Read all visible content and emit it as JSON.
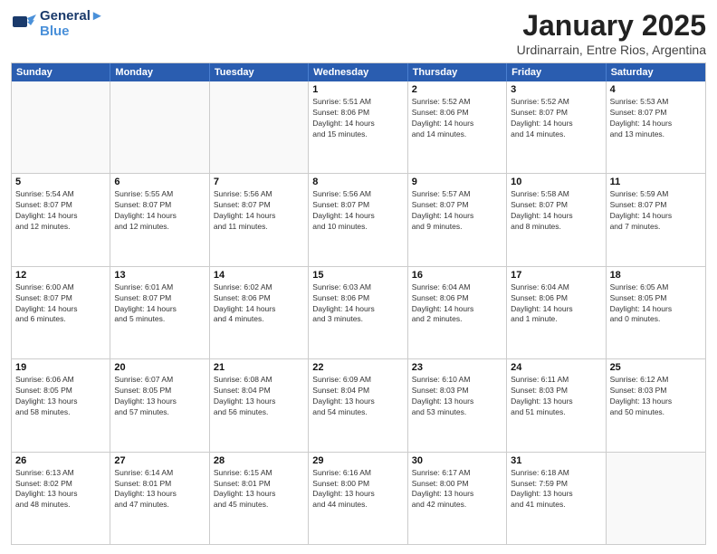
{
  "header": {
    "logo_line1": "General",
    "logo_line2": "Blue",
    "month": "January 2025",
    "location": "Urdinarrain, Entre Rios, Argentina"
  },
  "weekdays": [
    "Sunday",
    "Monday",
    "Tuesday",
    "Wednesday",
    "Thursday",
    "Friday",
    "Saturday"
  ],
  "rows": [
    [
      {
        "day": "",
        "text": ""
      },
      {
        "day": "",
        "text": ""
      },
      {
        "day": "",
        "text": ""
      },
      {
        "day": "1",
        "text": "Sunrise: 5:51 AM\nSunset: 8:06 PM\nDaylight: 14 hours\nand 15 minutes."
      },
      {
        "day": "2",
        "text": "Sunrise: 5:52 AM\nSunset: 8:06 PM\nDaylight: 14 hours\nand 14 minutes."
      },
      {
        "day": "3",
        "text": "Sunrise: 5:52 AM\nSunset: 8:07 PM\nDaylight: 14 hours\nand 14 minutes."
      },
      {
        "day": "4",
        "text": "Sunrise: 5:53 AM\nSunset: 8:07 PM\nDaylight: 14 hours\nand 13 minutes."
      }
    ],
    [
      {
        "day": "5",
        "text": "Sunrise: 5:54 AM\nSunset: 8:07 PM\nDaylight: 14 hours\nand 12 minutes."
      },
      {
        "day": "6",
        "text": "Sunrise: 5:55 AM\nSunset: 8:07 PM\nDaylight: 14 hours\nand 12 minutes."
      },
      {
        "day": "7",
        "text": "Sunrise: 5:56 AM\nSunset: 8:07 PM\nDaylight: 14 hours\nand 11 minutes."
      },
      {
        "day": "8",
        "text": "Sunrise: 5:56 AM\nSunset: 8:07 PM\nDaylight: 14 hours\nand 10 minutes."
      },
      {
        "day": "9",
        "text": "Sunrise: 5:57 AM\nSunset: 8:07 PM\nDaylight: 14 hours\nand 9 minutes."
      },
      {
        "day": "10",
        "text": "Sunrise: 5:58 AM\nSunset: 8:07 PM\nDaylight: 14 hours\nand 8 minutes."
      },
      {
        "day": "11",
        "text": "Sunrise: 5:59 AM\nSunset: 8:07 PM\nDaylight: 14 hours\nand 7 minutes."
      }
    ],
    [
      {
        "day": "12",
        "text": "Sunrise: 6:00 AM\nSunset: 8:07 PM\nDaylight: 14 hours\nand 6 minutes."
      },
      {
        "day": "13",
        "text": "Sunrise: 6:01 AM\nSunset: 8:07 PM\nDaylight: 14 hours\nand 5 minutes."
      },
      {
        "day": "14",
        "text": "Sunrise: 6:02 AM\nSunset: 8:06 PM\nDaylight: 14 hours\nand 4 minutes."
      },
      {
        "day": "15",
        "text": "Sunrise: 6:03 AM\nSunset: 8:06 PM\nDaylight: 14 hours\nand 3 minutes."
      },
      {
        "day": "16",
        "text": "Sunrise: 6:04 AM\nSunset: 8:06 PM\nDaylight: 14 hours\nand 2 minutes."
      },
      {
        "day": "17",
        "text": "Sunrise: 6:04 AM\nSunset: 8:06 PM\nDaylight: 14 hours\nand 1 minute."
      },
      {
        "day": "18",
        "text": "Sunrise: 6:05 AM\nSunset: 8:05 PM\nDaylight: 14 hours\nand 0 minutes."
      }
    ],
    [
      {
        "day": "19",
        "text": "Sunrise: 6:06 AM\nSunset: 8:05 PM\nDaylight: 13 hours\nand 58 minutes."
      },
      {
        "day": "20",
        "text": "Sunrise: 6:07 AM\nSunset: 8:05 PM\nDaylight: 13 hours\nand 57 minutes."
      },
      {
        "day": "21",
        "text": "Sunrise: 6:08 AM\nSunset: 8:04 PM\nDaylight: 13 hours\nand 56 minutes."
      },
      {
        "day": "22",
        "text": "Sunrise: 6:09 AM\nSunset: 8:04 PM\nDaylight: 13 hours\nand 54 minutes."
      },
      {
        "day": "23",
        "text": "Sunrise: 6:10 AM\nSunset: 8:03 PM\nDaylight: 13 hours\nand 53 minutes."
      },
      {
        "day": "24",
        "text": "Sunrise: 6:11 AM\nSunset: 8:03 PM\nDaylight: 13 hours\nand 51 minutes."
      },
      {
        "day": "25",
        "text": "Sunrise: 6:12 AM\nSunset: 8:03 PM\nDaylight: 13 hours\nand 50 minutes."
      }
    ],
    [
      {
        "day": "26",
        "text": "Sunrise: 6:13 AM\nSunset: 8:02 PM\nDaylight: 13 hours\nand 48 minutes."
      },
      {
        "day": "27",
        "text": "Sunrise: 6:14 AM\nSunset: 8:01 PM\nDaylight: 13 hours\nand 47 minutes."
      },
      {
        "day": "28",
        "text": "Sunrise: 6:15 AM\nSunset: 8:01 PM\nDaylight: 13 hours\nand 45 minutes."
      },
      {
        "day": "29",
        "text": "Sunrise: 6:16 AM\nSunset: 8:00 PM\nDaylight: 13 hours\nand 44 minutes."
      },
      {
        "day": "30",
        "text": "Sunrise: 6:17 AM\nSunset: 8:00 PM\nDaylight: 13 hours\nand 42 minutes."
      },
      {
        "day": "31",
        "text": "Sunrise: 6:18 AM\nSunset: 7:59 PM\nDaylight: 13 hours\nand 41 minutes."
      },
      {
        "day": "",
        "text": ""
      }
    ]
  ]
}
